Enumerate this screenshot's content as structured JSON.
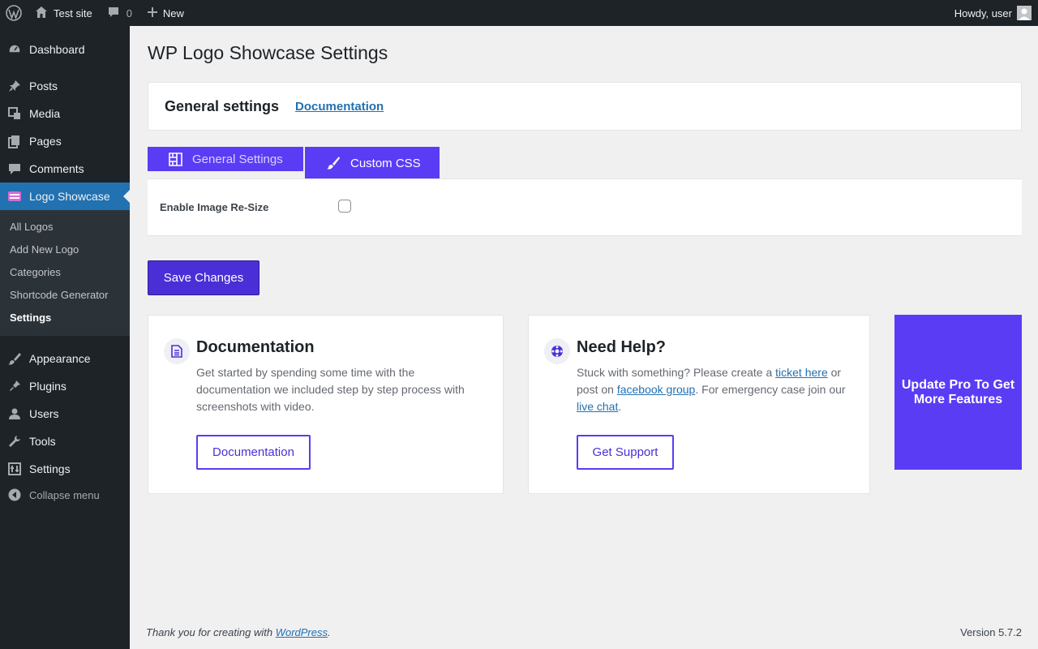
{
  "admin_bar": {
    "site_name": "Test site",
    "comments_count": "0",
    "new_label": "New",
    "howdy": "Howdy, user"
  },
  "sidebar": {
    "items": [
      {
        "label": "Dashboard",
        "icon": "dashboard-icon"
      },
      {
        "label": "Posts",
        "icon": "pin-icon"
      },
      {
        "label": "Media",
        "icon": "media-icon"
      },
      {
        "label": "Pages",
        "icon": "pages-icon"
      },
      {
        "label": "Comments",
        "icon": "comment-icon"
      },
      {
        "label": "Logo Showcase",
        "icon": "logo-showcase-icon"
      },
      {
        "label": "Appearance",
        "icon": "brush-icon"
      },
      {
        "label": "Plugins",
        "icon": "plugin-icon"
      },
      {
        "label": "Users",
        "icon": "user-icon"
      },
      {
        "label": "Tools",
        "icon": "wrench-icon"
      },
      {
        "label": "Settings",
        "icon": "settings-icon"
      },
      {
        "label": "Collapse menu",
        "icon": "collapse-icon"
      }
    ],
    "submenu": [
      "All Logos",
      "Add New Logo",
      "Categories",
      "Shortcode Generator",
      "Settings"
    ]
  },
  "main": {
    "page_title": "WP Logo Showcase Settings",
    "header": {
      "title": "General settings",
      "link": "Documentation"
    },
    "tabs": [
      {
        "label": "General Settings",
        "icon": "grid-icon"
      },
      {
        "label": "Custom CSS",
        "icon": "brush-icon"
      }
    ],
    "setting": {
      "label": "Enable Image Re-Size",
      "checked": false
    },
    "save_label": "Save Changes",
    "doc_card": {
      "title": "Documentation",
      "text": "Get started by spending some time with the documentation we included step by step process with screenshots with video.",
      "button": "Documentation"
    },
    "help_card": {
      "title": "Need Help?",
      "text_1": "Stuck with something? Please create a ",
      "link_ticket": "ticket here",
      "text_2": " or post on ",
      "link_facebook": "facebook group",
      "text_3": ". For emergency case join our ",
      "link_chat": "live chat",
      "text_4": ".",
      "button": "Get Support"
    },
    "pro_card": "Update Pro To Get More Features"
  },
  "footer": {
    "text": "Thank you for creating with ",
    "link": "WordPress",
    "period": ".",
    "version": "Version 5.7.2"
  },
  "colors": {
    "accent": "#5b3cf5",
    "admin_dark": "#1d2327",
    "link": "#2271b1"
  }
}
